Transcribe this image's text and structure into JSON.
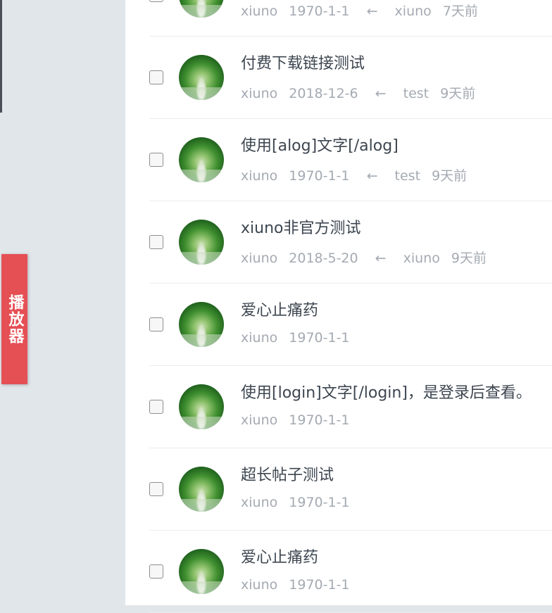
{
  "sidebar": {
    "player_label": "播放器"
  },
  "threads": [
    {
      "title": "",
      "author": "xiuno",
      "date": "1970-1-1",
      "last_user": "xiuno",
      "ago": "7天前"
    },
    {
      "title": "付费下载链接测试",
      "author": "xiuno",
      "date": "2018-12-6",
      "last_user": "test",
      "ago": "9天前"
    },
    {
      "title": "使用[alog]文字[/alog]",
      "author": "xiuno",
      "date": "1970-1-1",
      "last_user": "test",
      "ago": "9天前"
    },
    {
      "title": "xiuno非官方测试",
      "author": "xiuno",
      "date": "2018-5-20",
      "last_user": "xiuno",
      "ago": "9天前"
    },
    {
      "title": "爱心止痛药",
      "author": "xiuno",
      "date": "1970-1-1",
      "last_user": "",
      "ago": ""
    },
    {
      "title": "使用[login]文字[/login]，是登录后查看。",
      "author": "xiuno",
      "date": "1970-1-1",
      "last_user": "",
      "ago": ""
    },
    {
      "title": "超长帖子测试",
      "author": "xiuno",
      "date": "1970-1-1",
      "last_user": "",
      "ago": ""
    },
    {
      "title": "爱心止痛药",
      "author": "xiuno",
      "date": "1970-1-1",
      "last_user": "",
      "ago": ""
    }
  ],
  "icons": {
    "reply_arrow": "←"
  }
}
